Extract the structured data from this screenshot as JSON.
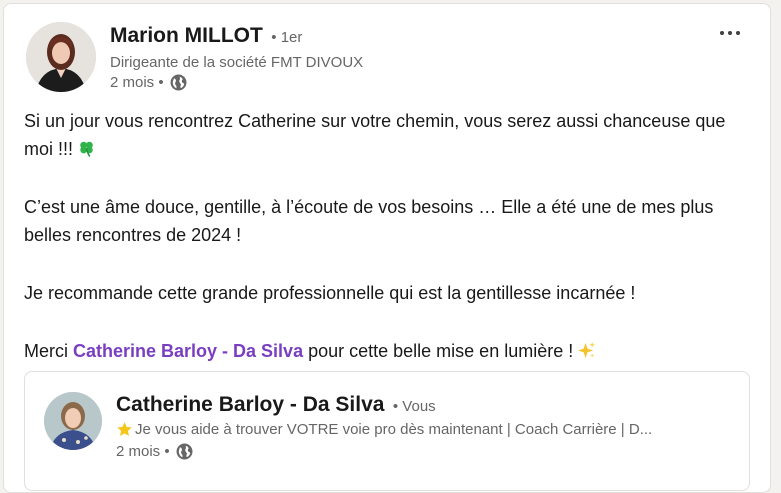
{
  "author": {
    "name": "Marion MILLOT",
    "degree": "• 1er",
    "headline": "Dirigeante de la société FMT DIVOUX",
    "time": "2 mois •"
  },
  "post": {
    "line1": "Si un jour vous rencontrez Catherine sur votre chemin, vous serez aussi chanceuse que moi !!!",
    "line2": "C’est une âme douce, gentille, à l’écoute de vos besoins … Elle a été une de mes plus belles rencontres de 2024 !",
    "line3": "Je recommande cette grande professionnelle qui est la gentillesse incarnée !",
    "line4_prefix": "Merci ",
    "line4_mention": "Catherine Barloy - Da Silva",
    "line4_suffix": " pour cette belle mise en lumière !"
  },
  "embedded": {
    "name": "Catherine Barloy - Da Silva",
    "degree": "• Vous",
    "headline": "Je vous aide à trouver VOTRE voie pro dès maintenant | Coach Carrière | D...",
    "time": "2 mois •"
  },
  "icons": {
    "more": "more-horizontal-icon",
    "globe": "globe-icon",
    "clover": "four-leaf-clover-emoji",
    "sparkles": "sparkles-emoji",
    "star": "star-emoji"
  },
  "colors": {
    "mention": "#7a3fc1",
    "secondary_text": "#666666",
    "primary_text": "#191919"
  }
}
